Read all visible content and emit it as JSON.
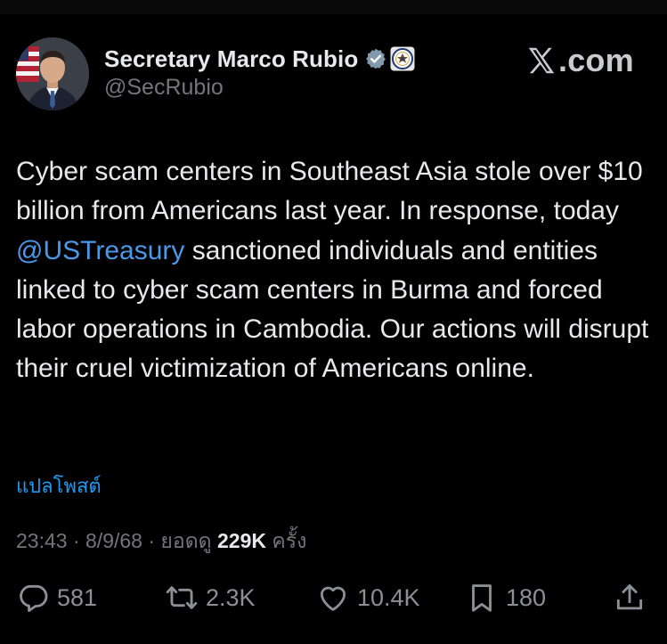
{
  "author": {
    "display_name": "Secretary Marco Rubio",
    "handle": "@SecRubio",
    "verified_icon": "verified-badge-icon",
    "affiliation_icon": "department-of-state-seal-icon"
  },
  "brand": {
    "text": ".com",
    "icon": "x-logo-icon"
  },
  "post": {
    "text_before_mention": "Cyber scam centers in Southeast Asia stole over $10 billion from Americans last year. In response, today ",
    "mention": "@USTreasury",
    "text_after_mention": " sanctioned individuals and entities linked to cyber scam centers in Burma and forced labor operations in Cambodia. Our actions will disrupt their cruel victimization of Americans online.",
    "translate_label": "แปลโพสต์"
  },
  "meta": {
    "time": "23:43",
    "separator1": " · ",
    "date": "8/9/68",
    "separator2": " · ",
    "views_label": "ยอดดู ",
    "views_count": "229K",
    "views_suffix": " ครั้ง"
  },
  "actions": {
    "replies": "581",
    "reposts": "2.3K",
    "likes": "10.4K",
    "bookmarks": "180"
  },
  "colors": {
    "background": "#000000",
    "text": "#e7e9ea",
    "secondary": "#71767b",
    "link": "#1d9bf0"
  }
}
